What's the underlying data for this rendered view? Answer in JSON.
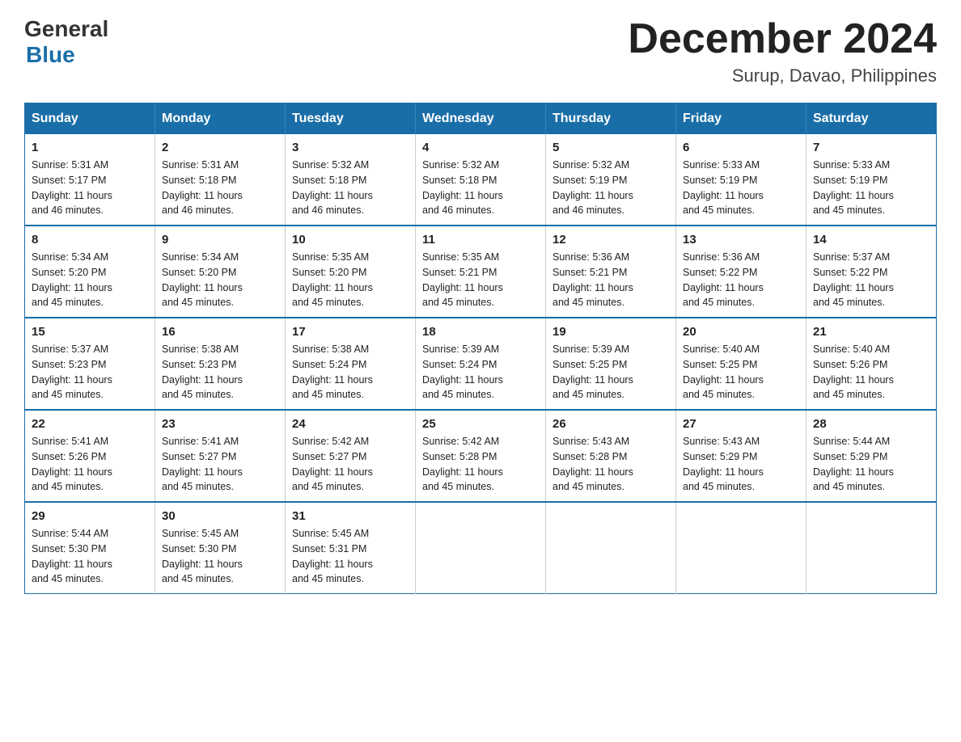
{
  "logo": {
    "general": "General",
    "blue": "Blue"
  },
  "header": {
    "month": "December 2024",
    "location": "Surup, Davao, Philippines"
  },
  "days_of_week": [
    "Sunday",
    "Monday",
    "Tuesday",
    "Wednesday",
    "Thursday",
    "Friday",
    "Saturday"
  ],
  "weeks": [
    [
      {
        "day": "1",
        "sunrise": "5:31 AM",
        "sunset": "5:17 PM",
        "daylight": "11 hours and 46 minutes."
      },
      {
        "day": "2",
        "sunrise": "5:31 AM",
        "sunset": "5:18 PM",
        "daylight": "11 hours and 46 minutes."
      },
      {
        "day": "3",
        "sunrise": "5:32 AM",
        "sunset": "5:18 PM",
        "daylight": "11 hours and 46 minutes."
      },
      {
        "day": "4",
        "sunrise": "5:32 AM",
        "sunset": "5:18 PM",
        "daylight": "11 hours and 46 minutes."
      },
      {
        "day": "5",
        "sunrise": "5:32 AM",
        "sunset": "5:19 PM",
        "daylight": "11 hours and 46 minutes."
      },
      {
        "day": "6",
        "sunrise": "5:33 AM",
        "sunset": "5:19 PM",
        "daylight": "11 hours and 45 minutes."
      },
      {
        "day": "7",
        "sunrise": "5:33 AM",
        "sunset": "5:19 PM",
        "daylight": "11 hours and 45 minutes."
      }
    ],
    [
      {
        "day": "8",
        "sunrise": "5:34 AM",
        "sunset": "5:20 PM",
        "daylight": "11 hours and 45 minutes."
      },
      {
        "day": "9",
        "sunrise": "5:34 AM",
        "sunset": "5:20 PM",
        "daylight": "11 hours and 45 minutes."
      },
      {
        "day": "10",
        "sunrise": "5:35 AM",
        "sunset": "5:20 PM",
        "daylight": "11 hours and 45 minutes."
      },
      {
        "day": "11",
        "sunrise": "5:35 AM",
        "sunset": "5:21 PM",
        "daylight": "11 hours and 45 minutes."
      },
      {
        "day": "12",
        "sunrise": "5:36 AM",
        "sunset": "5:21 PM",
        "daylight": "11 hours and 45 minutes."
      },
      {
        "day": "13",
        "sunrise": "5:36 AM",
        "sunset": "5:22 PM",
        "daylight": "11 hours and 45 minutes."
      },
      {
        "day": "14",
        "sunrise": "5:37 AM",
        "sunset": "5:22 PM",
        "daylight": "11 hours and 45 minutes."
      }
    ],
    [
      {
        "day": "15",
        "sunrise": "5:37 AM",
        "sunset": "5:23 PM",
        "daylight": "11 hours and 45 minutes."
      },
      {
        "day": "16",
        "sunrise": "5:38 AM",
        "sunset": "5:23 PM",
        "daylight": "11 hours and 45 minutes."
      },
      {
        "day": "17",
        "sunrise": "5:38 AM",
        "sunset": "5:24 PM",
        "daylight": "11 hours and 45 minutes."
      },
      {
        "day": "18",
        "sunrise": "5:39 AM",
        "sunset": "5:24 PM",
        "daylight": "11 hours and 45 minutes."
      },
      {
        "day": "19",
        "sunrise": "5:39 AM",
        "sunset": "5:25 PM",
        "daylight": "11 hours and 45 minutes."
      },
      {
        "day": "20",
        "sunrise": "5:40 AM",
        "sunset": "5:25 PM",
        "daylight": "11 hours and 45 minutes."
      },
      {
        "day": "21",
        "sunrise": "5:40 AM",
        "sunset": "5:26 PM",
        "daylight": "11 hours and 45 minutes."
      }
    ],
    [
      {
        "day": "22",
        "sunrise": "5:41 AM",
        "sunset": "5:26 PM",
        "daylight": "11 hours and 45 minutes."
      },
      {
        "day": "23",
        "sunrise": "5:41 AM",
        "sunset": "5:27 PM",
        "daylight": "11 hours and 45 minutes."
      },
      {
        "day": "24",
        "sunrise": "5:42 AM",
        "sunset": "5:27 PM",
        "daylight": "11 hours and 45 minutes."
      },
      {
        "day": "25",
        "sunrise": "5:42 AM",
        "sunset": "5:28 PM",
        "daylight": "11 hours and 45 minutes."
      },
      {
        "day": "26",
        "sunrise": "5:43 AM",
        "sunset": "5:28 PM",
        "daylight": "11 hours and 45 minutes."
      },
      {
        "day": "27",
        "sunrise": "5:43 AM",
        "sunset": "5:29 PM",
        "daylight": "11 hours and 45 minutes."
      },
      {
        "day": "28",
        "sunrise": "5:44 AM",
        "sunset": "5:29 PM",
        "daylight": "11 hours and 45 minutes."
      }
    ],
    [
      {
        "day": "29",
        "sunrise": "5:44 AM",
        "sunset": "5:30 PM",
        "daylight": "11 hours and 45 minutes."
      },
      {
        "day": "30",
        "sunrise": "5:45 AM",
        "sunset": "5:30 PM",
        "daylight": "11 hours and 45 minutes."
      },
      {
        "day": "31",
        "sunrise": "5:45 AM",
        "sunset": "5:31 PM",
        "daylight": "11 hours and 45 minutes."
      },
      null,
      null,
      null,
      null
    ]
  ],
  "labels": {
    "sunrise": "Sunrise:",
    "sunset": "Sunset:",
    "daylight": "Daylight:"
  }
}
